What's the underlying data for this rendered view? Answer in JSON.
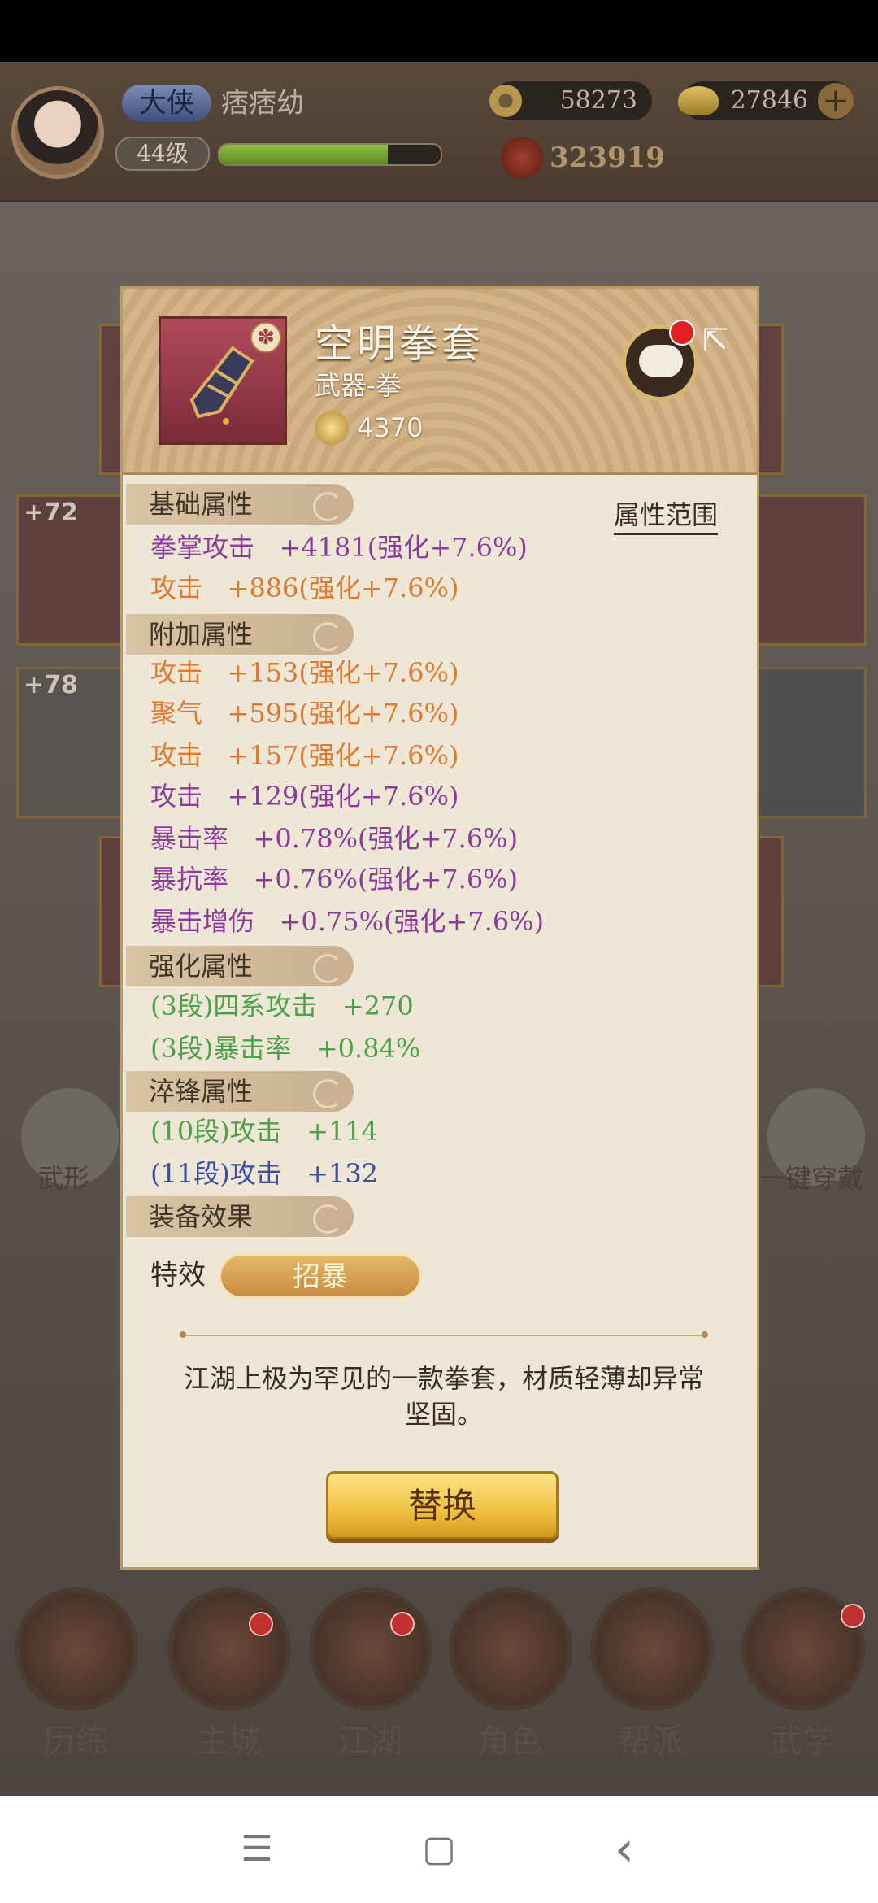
{
  "player": {
    "rank_badge": "大侠",
    "name": "痞痞幼",
    "level": "44级",
    "exp_fraction": 0.76,
    "coins": "58273",
    "ingots": "27846",
    "power": "323919"
  },
  "background": {
    "slot_levels": [
      "+72",
      "+78"
    ],
    "left_button_label": "武形",
    "right_button_label": "一键穿戴"
  },
  "nav": [
    {
      "label": "历练"
    },
    {
      "label": "主城"
    },
    {
      "label": "江湖"
    },
    {
      "label": "角色"
    },
    {
      "label": "帮派"
    },
    {
      "label": "武学"
    }
  ],
  "item": {
    "name": "空明拳套",
    "type": "武器-拳",
    "score": "4370",
    "quality_glyph": "✽"
  },
  "sections": {
    "base": "基础属性",
    "extra": "附加属性",
    "enhance": "强化属性",
    "temper": "淬锋属性",
    "effect": "装备效果"
  },
  "range_link": "属性范围",
  "base_stats": [
    "拳掌攻击   +4181(强化+7.6%)",
    "攻击   +886(强化+7.6%)"
  ],
  "extra_stats": [
    "攻击   +153(强化+7.6%)",
    "聚气   +595(强化+7.6%)",
    "攻击   +157(强化+7.6%)",
    "攻击   +129(强化+7.6%)",
    "暴击率   +0.78%(强化+7.6%)",
    "暴抗率   +0.76%(强化+7.6%)",
    "暴击增伤   +0.75%(强化+7.6%)"
  ],
  "enhance_stats": [
    "(3段)四系攻击   +270",
    "(3段)暴击率   +0.84%"
  ],
  "temper_stats": [
    "(10段)攻击   +114",
    "(11段)攻击   +132"
  ],
  "effect": {
    "label": "特效",
    "tag": "招暴"
  },
  "description": "江湖上极为罕见的一款拳套，材质轻薄却异常坚固。",
  "replace_button": "替换",
  "system_nav": {
    "menu": "☰",
    "home": "▢",
    "back": "‹"
  }
}
